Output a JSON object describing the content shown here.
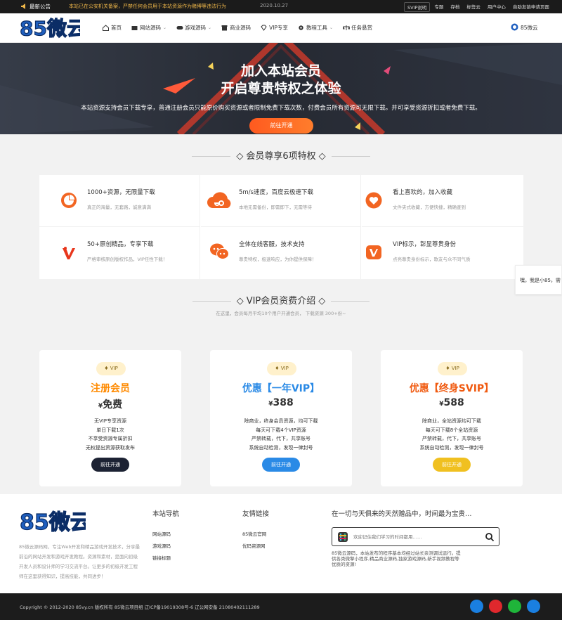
{
  "topbar": {
    "announce_label": "最新公告",
    "announce_text": "本站已在公安机关备案，严禁任何会员用于本站资源作为赌博等违法行为",
    "date": "2020.10.27",
    "links": [
      "SVIP说明",
      "专题",
      "存档",
      "标签云",
      "用户中心",
      "自助友链申请页面"
    ]
  },
  "nav": {
    "logo_text": "85微云",
    "menu": [
      {
        "label": "首页",
        "icon": "home-icon",
        "chevron": false
      },
      {
        "label": "网站源码",
        "icon": "folder-icon",
        "chevron": true
      },
      {
        "label": "游戏源码",
        "icon": "gamepad-icon",
        "chevron": true
      },
      {
        "label": "商业源码",
        "icon": "shop-icon",
        "chevron": false
      },
      {
        "label": "VIP专享",
        "icon": "diamond-icon",
        "chevron": false
      },
      {
        "label": "教程工具",
        "icon": "gear-icon",
        "chevron": true
      },
      {
        "label": "任务悬赏",
        "icon": "scale-icon",
        "chevron": false
      }
    ],
    "site_name": "85微云"
  },
  "hero": {
    "title_line1": "加入本站会员",
    "title_line2": "开启尊贵特权之体验",
    "subtitle": "本站资源支持会员下载专享，普通注册会员只能原价购买资源或者限制免费下载次数，付费会员所有资源可无限下载。并可享受资源折扣或者免费下载。",
    "button": "前往开通"
  },
  "privileges": {
    "title": "会员尊享6项特权",
    "items": [
      {
        "title": "1000+资源，无限量下载",
        "desc": "真正的海量，无套路，诚意满满",
        "icon": "pie-chart-icon",
        "color": "#f26522"
      },
      {
        "title": "5m/s速度，百度云极速下载",
        "desc": "本地无需备份，即需即下，无需等待",
        "icon": "cloud-icon",
        "color": "#f26522"
      },
      {
        "title": "看上喜欢的，加入收藏",
        "desc": "文件夹式收藏，方便快捷，精确查到",
        "icon": "heart-icon",
        "color": "#f26522"
      },
      {
        "title": "50+原创精品，专享下载",
        "desc": "严格审核原创版权作品，VIP任性下载！",
        "icon": "v-icon",
        "color": "#e8361c"
      },
      {
        "title": "全体在线客服，技术支持",
        "desc": "尊贵特权，极速响应，为你提供保障！",
        "icon": "chat-icon",
        "color": "#f26522"
      },
      {
        "title": "VIP标示，彰显尊贵身份",
        "desc": "点亮尊贵身份标示，歌友与众不同气质",
        "icon": "vip-badge-icon",
        "color": "#f26522"
      }
    ]
  },
  "side_tab": "嘿，我是小85，需",
  "pricing": {
    "title": "VIP会员资费介绍",
    "subtitle": "在这里，会员每月平均10个用户开通会员， 下载资源 300+份~",
    "plans": [
      {
        "badge": "VIP",
        "name": "注册会员",
        "currency": "¥",
        "price": "免费",
        "color": "#ff8a00",
        "features": [
          "无VIP专享资源",
          "单日下载1次",
          "不享受资源专属折扣",
          "无权提出资源获取发布"
        ],
        "button": "前往开通",
        "button_color": "#1c2233"
      },
      {
        "badge": "VIP",
        "name": "优惠【一年VIP】",
        "currency": "¥",
        "price": "388",
        "color": "#2a8ae6",
        "features": [
          "除商业，终身会员资源，均可下载",
          "每天可下载4个VIP资源",
          "严禁转载，代下，共享账号",
          "系统自动检测，发现一律封号"
        ],
        "button": "前往开通",
        "button_color": "#2a8ae6"
      },
      {
        "badge": "VIP",
        "name": "优惠【终身SVIP】",
        "currency": "¥",
        "price": "588",
        "color": "#f05a10",
        "features": [
          "除商业，全站资源均可下载",
          "每天可下载8个全站资源",
          "严禁转载，代下，共享账号",
          "系统自动检测，发现一律封号"
        ],
        "button": "前往开通",
        "button_color": "#f0c020"
      }
    ]
  },
  "footer": {
    "about": "85微云源码网，专注Web开发和精品游戏开发技术，分享最前沿的网站开发和游戏开发教程。资源和素材，是面向初级开发人员和设计师的学习交流平台。让更多的初级开发工程师在这里获得知识，提高技能，共同进步！",
    "nav_title": "本站导航",
    "nav_links": [
      "网站源码",
      "游戏源码",
      "链接标题"
    ],
    "friend_title": "友情链接",
    "friend_links": [
      "85微云官网",
      "优码资源网"
    ],
    "slogan": "在一切与天俱来的天然赠品中，时间最为宝贵…",
    "search_placeholder": "欢迎记住我们学习的时间都用……",
    "note": "85微云源码，本站发布的程序基本均经过站长亲测调试运行。提供各类微擎小程序,精品商业源码,独家游戏源码,新手视频教程等优质的资源!"
  },
  "bottombar": {
    "copyright": "Copyright © 2012-2020 85vy.cn 版权所有 85微云项目组  辽ICP备19019308号-6   辽公网安备 21080402111289",
    "social": [
      {
        "icon": "qq-icon",
        "color": "#1a7fe0"
      },
      {
        "icon": "weibo-icon",
        "color": "#e0282d"
      },
      {
        "icon": "wechat-icon",
        "color": "#1fb53a"
      },
      {
        "icon": "email-icon",
        "color": "#1a7fe0"
      }
    ]
  }
}
